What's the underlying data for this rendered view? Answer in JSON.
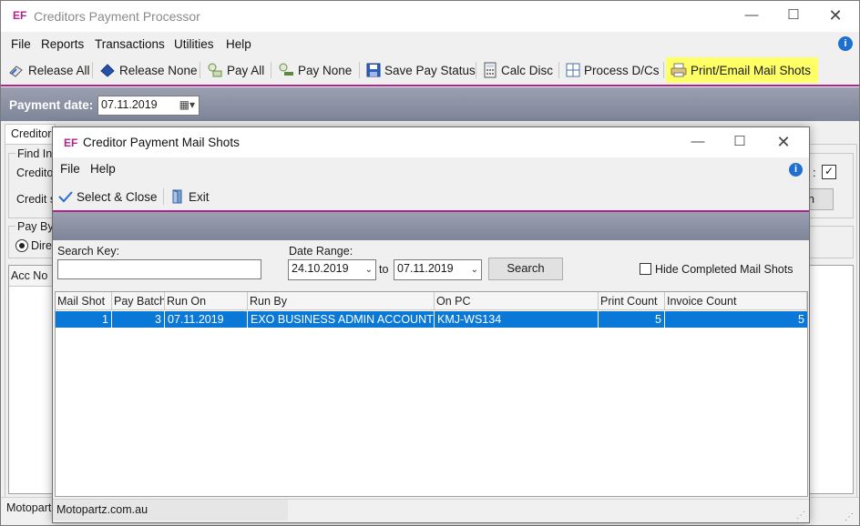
{
  "main_window": {
    "logo": "EF",
    "title": "Creditors Payment Processor",
    "menu": [
      "File",
      "Reports",
      "Transactions",
      "Utilities",
      "Help"
    ],
    "toolbar": {
      "release_all": "Release All",
      "release_none": "Release None",
      "pay_all": "Pay All",
      "pay_none": "Pay None",
      "save_pay_status": "Save Pay Status",
      "calc_disc": "Calc Disc",
      "process_dcs": "Process D/Cs",
      "print_email": "Print/Email Mail Shots"
    },
    "payment_date_label": "Payment date:",
    "payment_date_value": "07.11.2019",
    "partial": {
      "tab_creditor": "Creditor",
      "find_in": "Find In",
      "creditor_line": "Credito",
      "creditor_s": "Credit s",
      "pay_by": "Pay By",
      "direct": "Dire",
      "acc_no": "Acc No",
      "status_left": "Motopart",
      "check_label_fragment": ":",
      "button_fragment": "n"
    }
  },
  "dialog": {
    "logo": "EF",
    "title": "Creditor Payment Mail Shots",
    "menu": [
      "File",
      "Help"
    ],
    "toolbar": {
      "select_close": "Select & Close",
      "exit": "Exit"
    },
    "search_key_label": "Search Key:",
    "search_key_value": "",
    "date_range_label": "Date Range:",
    "date_from": "24.10.2019",
    "to_label": "to",
    "date_to": "07.11.2019",
    "search_button": "Search",
    "hide_completed_label": "Hide Completed Mail Shots",
    "hide_completed_checked": false,
    "grid": {
      "columns": [
        "Mail Shot",
        "Pay Batch",
        "Run On",
        "Run By",
        "On PC",
        "Print Count",
        "Invoice Count"
      ],
      "rows": [
        [
          "1",
          "3",
          "07.11.2019",
          "EXO BUSINESS ADMIN ACCOUNT",
          "KMJ-WS134",
          "5",
          "5"
        ]
      ]
    },
    "status": "Motopartz.com.au"
  },
  "colors": {
    "accent_magenta": "#b0238f",
    "selection_blue": "#0a78d7",
    "highlight_yellow": "#ffff66"
  }
}
